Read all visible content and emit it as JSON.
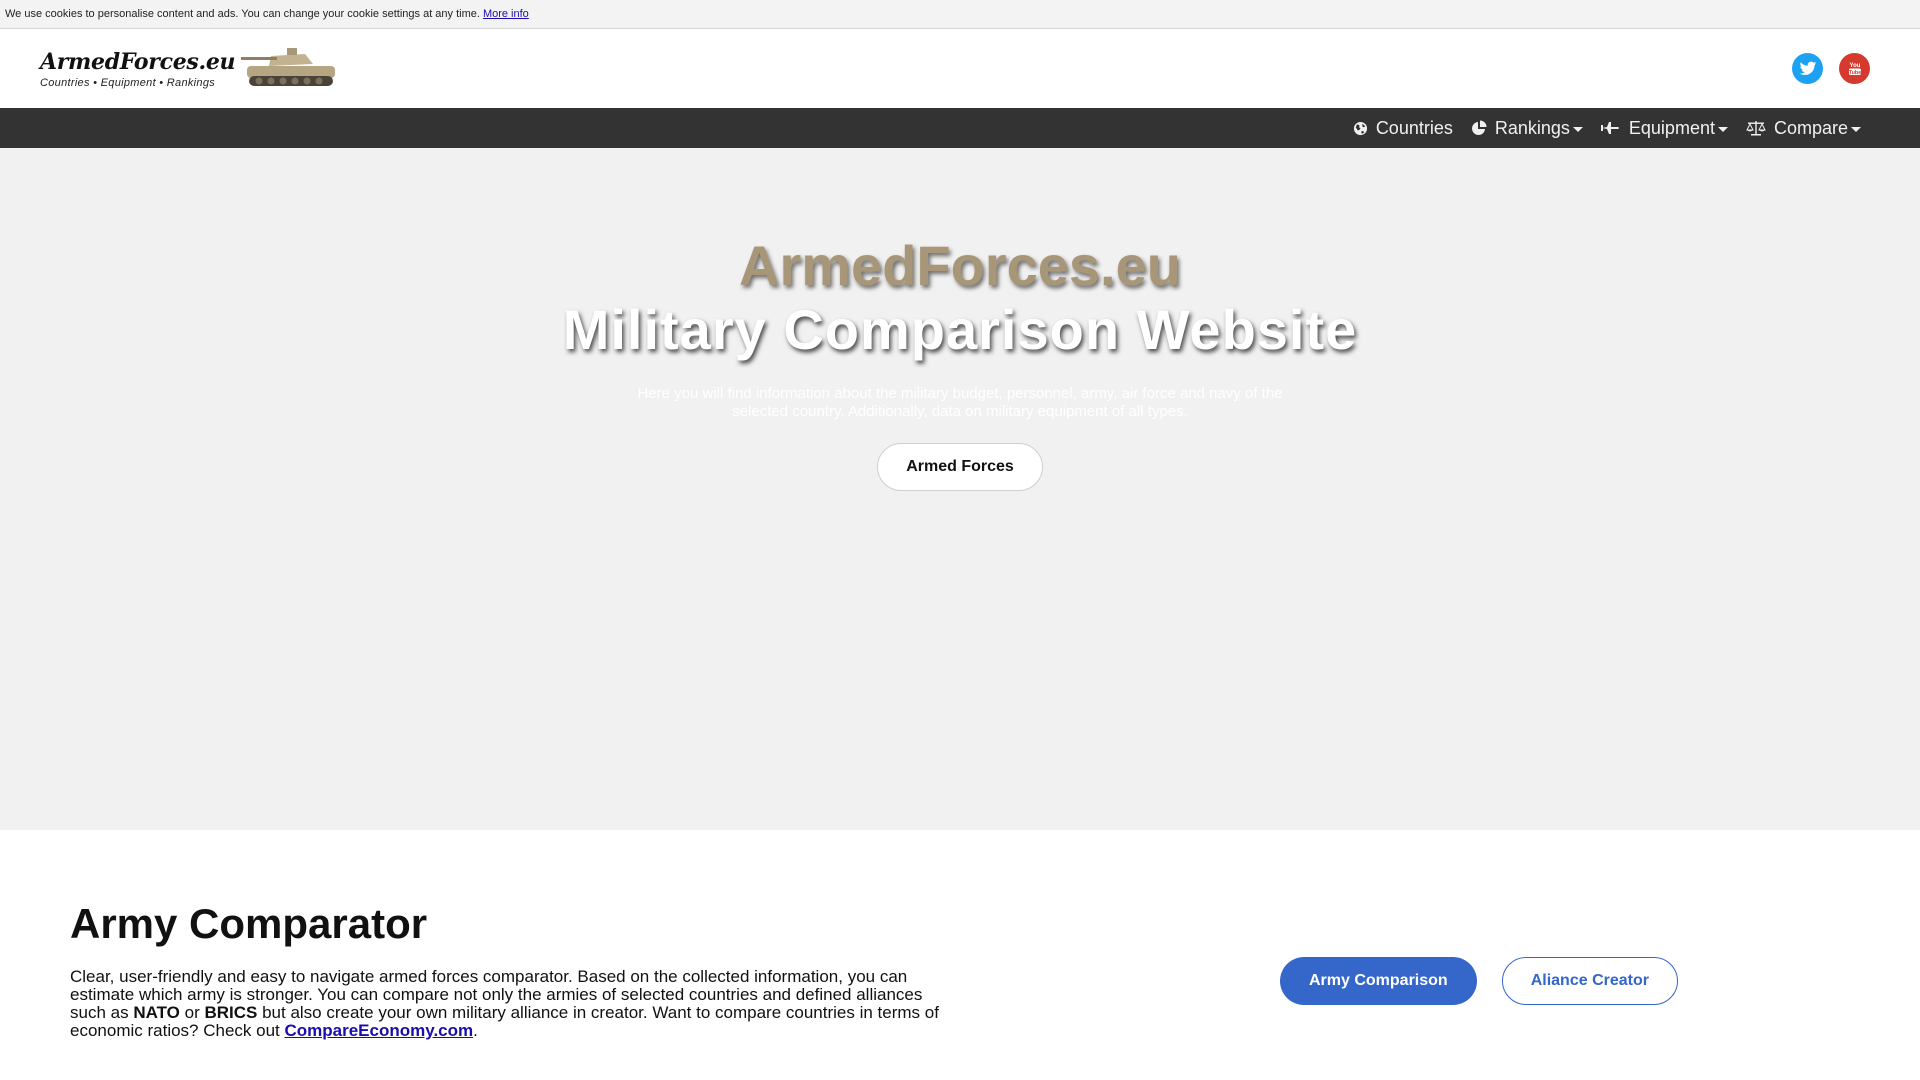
{
  "cookie": {
    "text": "We use cookies to personalise content and ads. You can change your cookie settings at any time.",
    "link": "More info"
  },
  "header": {
    "logo_title": "ArmedForces.eu",
    "logo_tagline": "Countries • Equipment • Rankings",
    "socials": [
      "twitter-icon",
      "youtube-icon"
    ],
    "colors": {
      "twitter": "#1da1f2",
      "youtube": "#d63a2e"
    }
  },
  "nav": {
    "items": [
      {
        "label": "Countries",
        "icon": "globe-icon",
        "dropdown": false
      },
      {
        "label": "Rankings",
        "icon": "pie-chart-icon",
        "dropdown": true
      },
      {
        "label": "Equipment",
        "icon": "plane-icon",
        "dropdown": true
      },
      {
        "label": "Compare",
        "icon": "scales-icon",
        "dropdown": true
      }
    ]
  },
  "hero": {
    "title": "ArmedForces.eu",
    "subtitle": "Military Comparison Website",
    "description": "Here you will find information about the military budget, personnel, army, air force and navy of the selected country. Additionally, data on military equipment of all types.",
    "button": "Armed Forces"
  },
  "comparator": {
    "title": "Army Comparator",
    "desc_part1": "Clear, user-friendly and easy to navigate armed forces comparator. Based on the collected information, you can estimate which army is stronger. You can compare not only the armies of selected countries and defined alliances such as ",
    "nato": "NATO",
    "or": " or ",
    "brics": "BRICS",
    "desc_part2": " but also create your own military alliance in creator. Want to compare countries in terms of economic ratios? Check out ",
    "link": "CompareEconomy.com",
    "period": ".",
    "btn_primary": "Army Comparison",
    "btn_secondary": "Aliance Creator"
  }
}
